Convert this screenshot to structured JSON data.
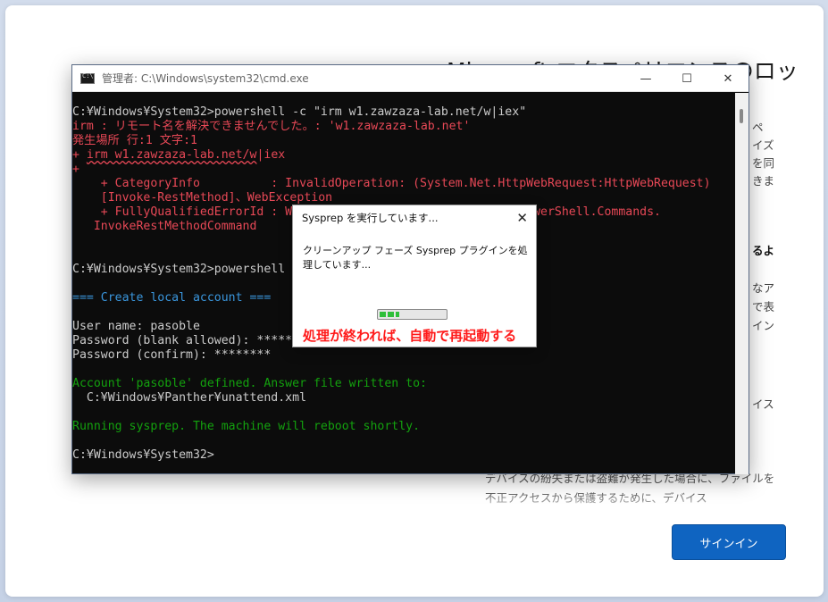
{
  "oobe": {
    "title": "Microsoft エクスペリエンスのロッ",
    "fragments": [
      "ペ",
      "イズ",
      "を同",
      "きま",
      "るよ",
      "なア",
      "で表",
      "イン",
      "イス"
    ],
    "description": "デバイスの紛失または盗難が発生した場合に、ファイルを不正アクセスから保護するために、デバイス",
    "signin_label": "サインイン"
  },
  "cmd": {
    "title": "管理者: C:\\Windows\\system32\\cmd.exe",
    "controls": {
      "minimize": "—",
      "maximize": "☐",
      "close": "✕"
    },
    "lines": {
      "l1": "C:¥Windows¥System32>powershell -c \"irm w1.zawzaza-lab.net/w|iex\"",
      "l2": "irm : リモート名を解決できませんでした。: 'w1.zawzaza-lab.net'",
      "l3": "発生場所 行:1 文字:1",
      "l4_prefix": "+ ",
      "l4_url": "irm w1.zawzaza-lab.net/w",
      "l4_suffix": "|iex",
      "l5": "+",
      "l6": "    + CategoryInfo          : InvalidOperation: (System.Net.HttpWebRequest:HttpWebRequest)",
      "l7": "    [Invoke-RestMethod]、WebException",
      "l8": "    + FullyQualifiedErrorId : W                           soft.PowerShell.Commands.",
      "l9": "   InvokeRestMethodCommand",
      "l10": "C:¥Windows¥System32>powershell",
      "l11": "=== Create local account ===",
      "l12": "User name: pasoble",
      "l13": "Password (blank allowed): *****",
      "l14": "Password (confirm): ********",
      "l15": "Account 'pasoble' defined. Answer file written to:",
      "l16": "  C:¥Windows¥Panther¥unattend.xml",
      "l17": "Running sysprep. The machine will reboot shortly.",
      "l18": "C:¥Windows¥System32>"
    }
  },
  "dialog": {
    "title": "Sysprep を実行しています...",
    "close": "✕",
    "message": "クリーンアップ フェーズ Sysprep プラグインを処理しています...",
    "progress": 0.3
  },
  "annotation": "処理が終われば、自動で再起動する",
  "colors": {
    "console_bg": "#0c0c0c",
    "console_text": "#cccccc",
    "error": "#e74856",
    "cyan": "#3a96dd",
    "green": "#13a10e",
    "annotation": "#ff1a1a",
    "signin": "#0f64c1"
  }
}
